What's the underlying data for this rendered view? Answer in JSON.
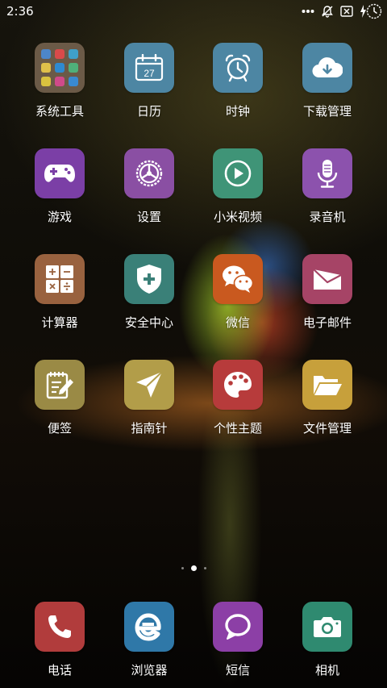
{
  "status_bar": {
    "time": "2:36",
    "icons": [
      "more-dots-icon",
      "notifications-off-icon",
      "sim-missing-icon",
      "battery-charging-icon"
    ]
  },
  "home_screen": {
    "rows": [
      [
        {
          "label": "系统工具",
          "icon": "folder-icon",
          "color": "#6b5a47"
        },
        {
          "label": "日历",
          "icon": "calendar-icon",
          "color": "#4d86a3",
          "date": "27"
        },
        {
          "label": "时钟",
          "icon": "alarm-clock-icon",
          "color": "#4d86a3"
        },
        {
          "label": "下载管理",
          "icon": "cloud-download-icon",
          "color": "#4d86a3"
        }
      ],
      [
        {
          "label": "游戏",
          "icon": "gamepad-icon",
          "color": "#7b3fa6"
        },
        {
          "label": "设置",
          "icon": "steering-gear-icon",
          "color": "#8a4fa3"
        },
        {
          "label": "小米视频",
          "icon": "play-circle-icon",
          "color": "#3f9477"
        },
        {
          "label": "录音机",
          "icon": "microphone-icon",
          "color": "#8c52ad"
        }
      ],
      [
        {
          "label": "计算器",
          "icon": "calculator-icon",
          "color": "#99623f"
        },
        {
          "label": "安全中心",
          "icon": "shield-plus-icon",
          "color": "#3a8078"
        },
        {
          "label": "微信",
          "icon": "wechat-icon",
          "color": "#c9591f"
        },
        {
          "label": "电子邮件",
          "icon": "envelope-icon",
          "color": "#a64466"
        }
      ],
      [
        {
          "label": "便签",
          "icon": "note-pencil-icon",
          "color": "#9a8a45"
        },
        {
          "label": "指南针",
          "icon": "paper-plane-icon",
          "color": "#b29d49"
        },
        {
          "label": "个性主题",
          "icon": "palette-icon",
          "color": "#b73b3b"
        },
        {
          "label": "文件管理",
          "icon": "folder-open-icon",
          "color": "#c7a03b"
        }
      ]
    ],
    "page_indicator": {
      "pages": 3,
      "current": 2
    }
  },
  "dock": [
    {
      "label": "电话",
      "icon": "phone-icon",
      "color": "#b13c3c"
    },
    {
      "label": "浏览器",
      "icon": "browser-e-icon",
      "color": "#2f78a8"
    },
    {
      "label": "短信",
      "icon": "message-bubble-icon",
      "color": "#8c3fa6"
    },
    {
      "label": "相机",
      "icon": "camera-icon",
      "color": "#2f8a70"
    }
  ]
}
